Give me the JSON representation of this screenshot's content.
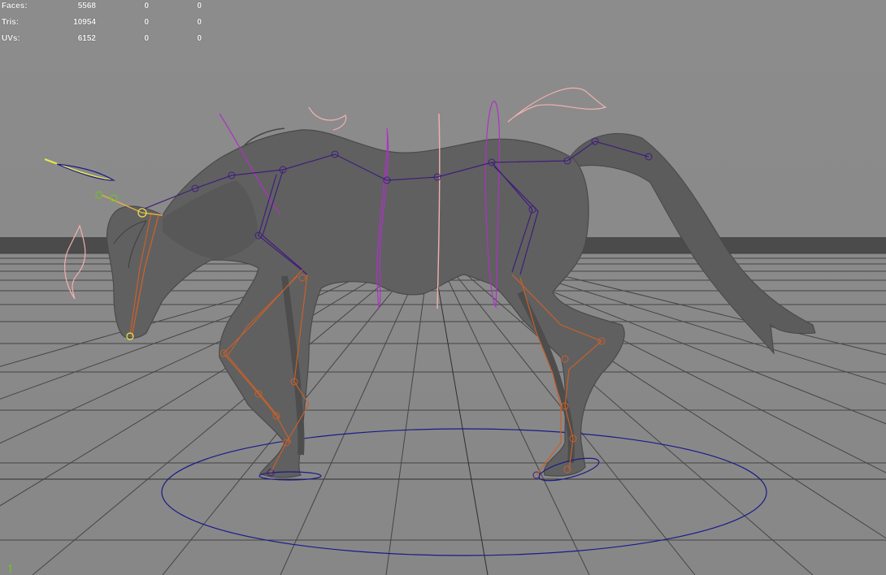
{
  "hud": {
    "rows": [
      {
        "label": "Faces:",
        "values": [
          "5568",
          "0",
          "0"
        ]
      },
      {
        "label": "Tris:",
        "values": [
          "10954",
          "0",
          "0"
        ]
      },
      {
        "label": "UVs:",
        "values": [
          "6152",
          "0",
          "0"
        ]
      }
    ]
  },
  "viewport": {
    "colors": {
      "background": "#8a8a8a",
      "grid": "#4a4a4a",
      "ground_band": "#474747",
      "mesh": "#5f5f5f",
      "mesh_shadow": "#4e4e4e",
      "joint_purple": "#3f1f7a",
      "joint_orange": "#c8602a",
      "control_magenta": "#b030c8",
      "control_pink": "#f2b0b0",
      "control_blue": "#1a1a8a",
      "control_yellow": "#e8e84a",
      "control_green": "#6ec02a"
    },
    "icons": [
      "grid-floor",
      "horse-mesh",
      "skeleton-joints",
      "control-curves",
      "axis-indicator-icon"
    ]
  }
}
